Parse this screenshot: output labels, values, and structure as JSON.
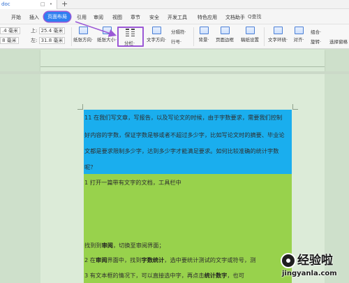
{
  "titlebar": {
    "doc_tab": "doc",
    "tab_icons": "□ •",
    "new_tab": "+"
  },
  "menubar": {
    "items": [
      "开始",
      "插入",
      "页面布局",
      "引用",
      "审阅",
      "视图",
      "章节",
      "安全",
      "开发工具",
      "特色应用",
      "文档助手"
    ],
    "search": "Q查找"
  },
  "ribbon": {
    "margin_top_label": "上:",
    "margin_top_value": "25.4 毫米",
    "margin_left_label": "左:",
    "margin_left_value": "31.8 毫米",
    "field_a_value": ".4 毫米",
    "field_b_value": "8 毫米",
    "buttons": {
      "orientation": "纸张方向·",
      "size": "纸张大小·",
      "columns": "分栏·",
      "text_direction": "文字方向·",
      "separator": "分隔符·",
      "line_number": "行号·",
      "background": "背景·",
      "page_border": "页面边框",
      "paper_setup": "稿纸设置",
      "text_wrap": "文字环绕·",
      "align": "对齐·",
      "group": "组合·",
      "rotate": "旋转·",
      "select_pane": "选择窗格"
    },
    "colors": {
      "highlight_outline": "#9b58d6",
      "active_tab": "#2f7ff0"
    }
  },
  "document": {
    "lines": [
      {
        "text": "11 在我们写文章，写报告，以及写论文的时候，由于字数要求，需要我们控制"
      },
      {
        "text": "好内容的字数，保证字数是够或者不超过多少字，比如写论文时的摘要、毕业论"
      },
      {
        "text": "文都是要求限制多少字，达到多少字才能满足要求。如何比较准确的统计字数"
      },
      {
        "text": "呢？"
      },
      {
        "text": "1 打开一篇带有文字的文档，工具栏中"
      },
      {
        "pre": "找到到",
        "bold": "审阅",
        "post": "，切换至审阅界面；"
      },
      {
        "pre": "2 在",
        "bold": "审阅",
        "post": "界面中，找到",
        "bold2": "字数统计",
        "post2": "，选中要统计测试的文字或符号，测"
      },
      {
        "pre": "3 有文本框的情况下，可以直接选中字，再点击",
        "bold": "统计数字",
        "post": "，也可"
      }
    ],
    "colors": {
      "selection_blue": "#1aaeee",
      "selection_green": "#98d24c"
    }
  },
  "watermark": {
    "title": "经验啦",
    "check": "✓",
    "url": "jingyanla.com"
  }
}
